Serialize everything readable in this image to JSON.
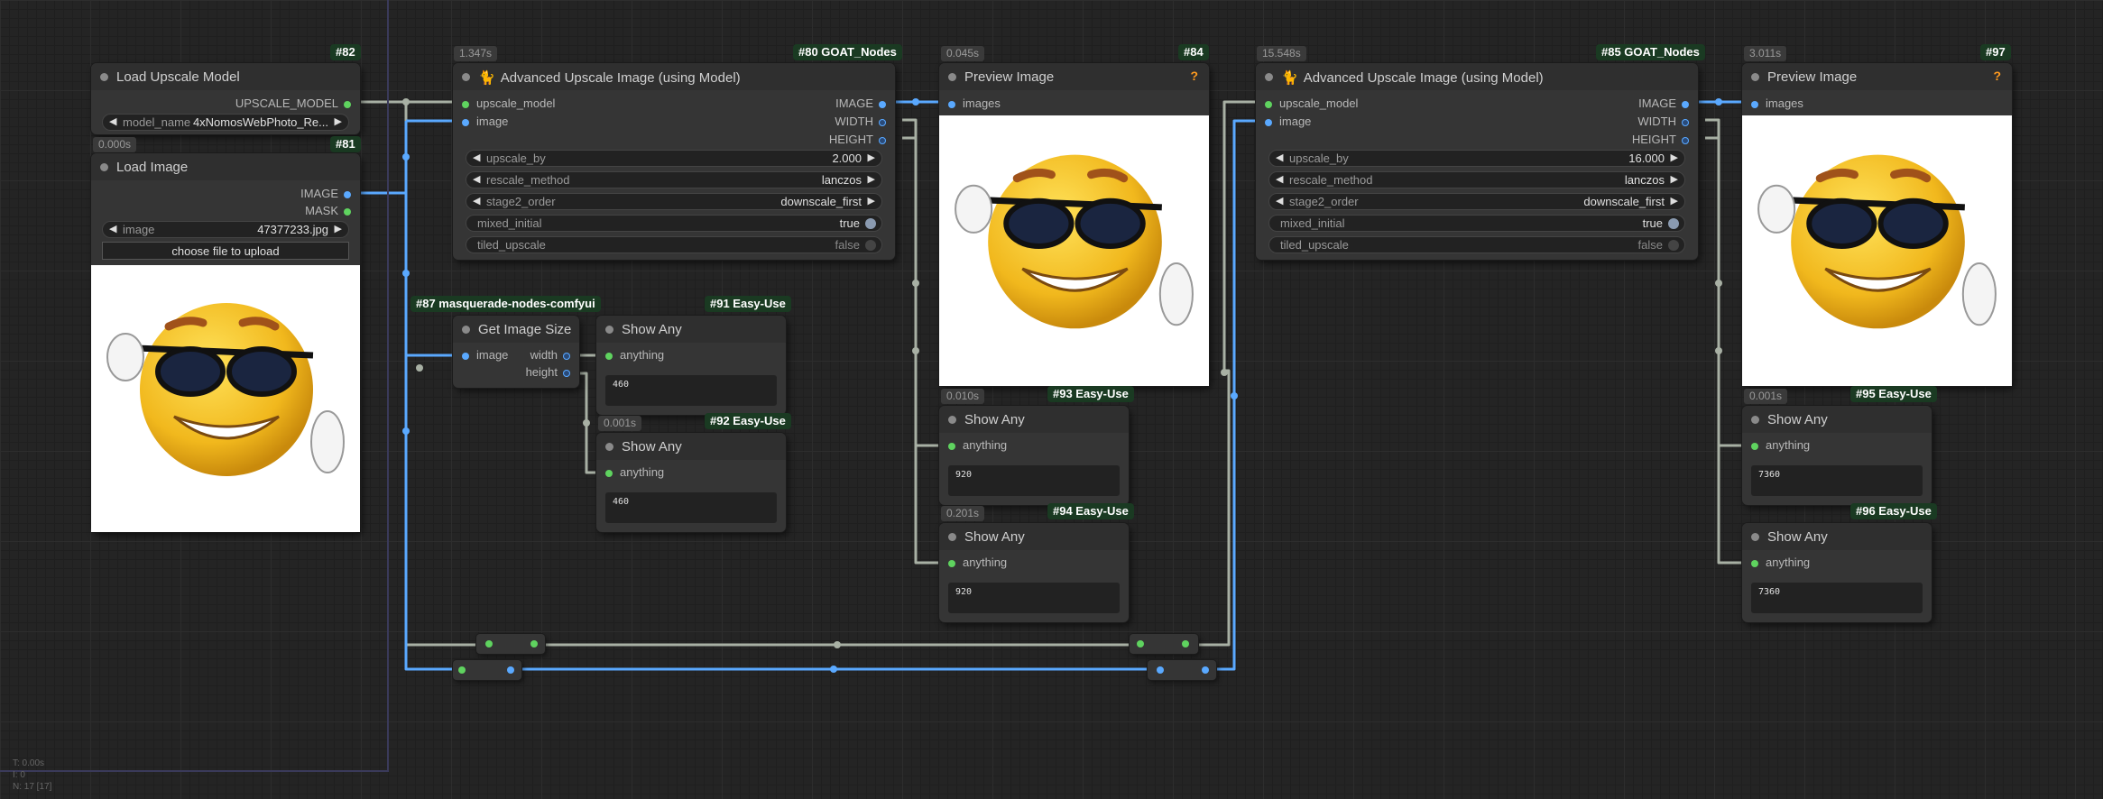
{
  "nodes": {
    "load_upscale_model": {
      "id": "#82",
      "title": "Load Upscale Model",
      "output": "UPSCALE_MODEL",
      "widget": {
        "label": "model_name",
        "value": "4xNomosWebPhoto_Re..."
      }
    },
    "load_image": {
      "id": "#81",
      "time": "0.000s",
      "title": "Load Image",
      "outputs": [
        "IMAGE",
        "MASK"
      ],
      "widget": {
        "label": "image",
        "value": "47377233.jpg"
      },
      "upload_button": "choose file to upload"
    },
    "adv_upscale_1": {
      "id": "#80 GOAT_Nodes",
      "time": "1.347s",
      "title": "Advanced Upscale Image (using Model)",
      "inputs": [
        "upscale_model",
        "image"
      ],
      "outputs": [
        "IMAGE",
        "WIDTH",
        "HEIGHT"
      ],
      "widgets": [
        {
          "label": "upscale_by",
          "value": "2.000"
        },
        {
          "label": "rescale_method",
          "value": "lanczos"
        },
        {
          "label": "stage2_order",
          "value": "downscale_first"
        }
      ],
      "toggles": [
        {
          "label": "mixed_initial",
          "value": "true"
        },
        {
          "label": "tiled_upscale",
          "value": "false"
        }
      ]
    },
    "preview_1": {
      "id": "#84",
      "time": "0.045s",
      "title": "Preview Image",
      "input": "images"
    },
    "adv_upscale_2": {
      "id": "#85 GOAT_Nodes",
      "time": "15.548s",
      "title": "Advanced Upscale Image (using Model)",
      "inputs": [
        "upscale_model",
        "image"
      ],
      "outputs": [
        "IMAGE",
        "WIDTH",
        "HEIGHT"
      ],
      "widgets": [
        {
          "label": "upscale_by",
          "value": "16.000"
        },
        {
          "label": "rescale_method",
          "value": "lanczos"
        },
        {
          "label": "stage2_order",
          "value": "downscale_first"
        }
      ],
      "toggles": [
        {
          "label": "mixed_initial",
          "value": "true"
        },
        {
          "label": "tiled_upscale",
          "value": "false"
        }
      ]
    },
    "preview_2": {
      "id": "#97",
      "time": "3.011s",
      "title": "Preview Image",
      "input": "images"
    },
    "get_size": {
      "id": "#87 masquerade-nodes-comfyui",
      "title": "Get Image Size",
      "input": "image",
      "outputs": [
        "width",
        "height"
      ]
    },
    "show_91": {
      "id": "#91 Easy-Use",
      "title": "Show Any",
      "input": "anything",
      "value": "460"
    },
    "show_92": {
      "id": "#92 Easy-Use",
      "time": "0.001s",
      "title": "Show Any",
      "input": "anything",
      "value": "460"
    },
    "show_93": {
      "id": "#93 Easy-Use",
      "time": "0.010s",
      "title": "Show Any",
      "input": "anything",
      "value": "920"
    },
    "show_94": {
      "id": "#94 Easy-Use",
      "time": "0.201s",
      "title": "Show Any",
      "input": "anything",
      "value": "920"
    },
    "show_95": {
      "id": "#95 Easy-Use",
      "time": "0.001s",
      "title": "Show Any",
      "input": "anything",
      "value": "7360"
    },
    "show_96": {
      "id": "#96 Easy-Use",
      "title": "Show Any",
      "input": "anything",
      "value": "7360"
    }
  },
  "stats": {
    "line1": "T: 0.00s",
    "line2": "I: 0",
    "line3": "N: 17 [17]"
  },
  "colors": {
    "image_link": "#5aa9ff",
    "generic_link": "#a8b0a4",
    "node_bg": "#353535",
    "id_badge": "#1a3a22"
  }
}
